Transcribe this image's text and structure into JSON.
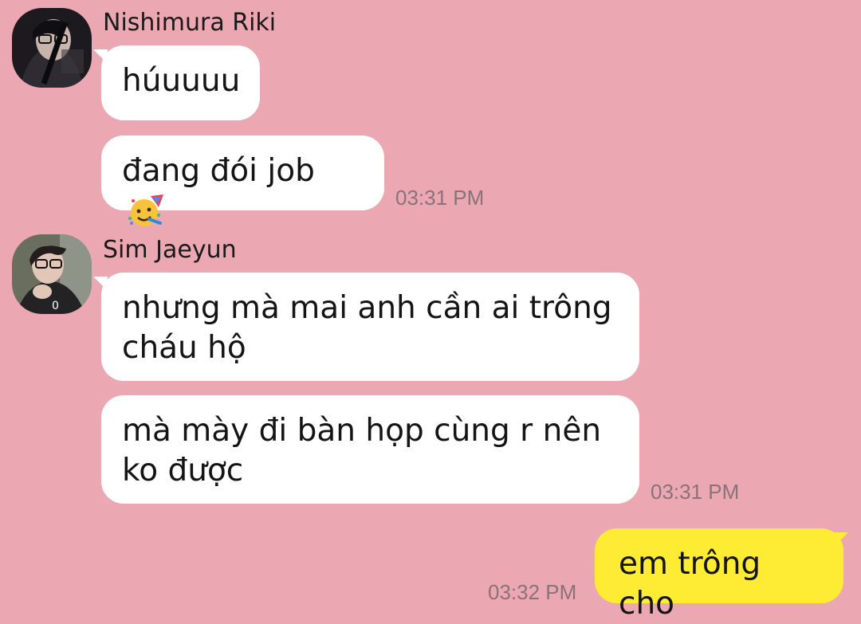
{
  "messages": [
    {
      "sender": "Nishimura Riki",
      "bubbles": [
        "húuuuu",
        "đang đói job"
      ],
      "emoji": "partying-face",
      "time": "03:31 PM"
    },
    {
      "sender": "Sim Jaeyun",
      "bubbles": [
        "nhưng mà mai anh cần ai trông cháu hộ",
        "mà mày đi bàn họp cùng r nên ko được"
      ],
      "time": "03:31 PM"
    },
    {
      "sender": "",
      "bubbles": [
        "em trông cho"
      ],
      "time": "03:32 PM",
      "outgoing": true
    }
  ],
  "colors": {
    "background": "#eba8b2",
    "incoming_bubble": "#ffffff",
    "outgoing_bubble": "#fdec33",
    "timestamp": "#8a7378"
  }
}
